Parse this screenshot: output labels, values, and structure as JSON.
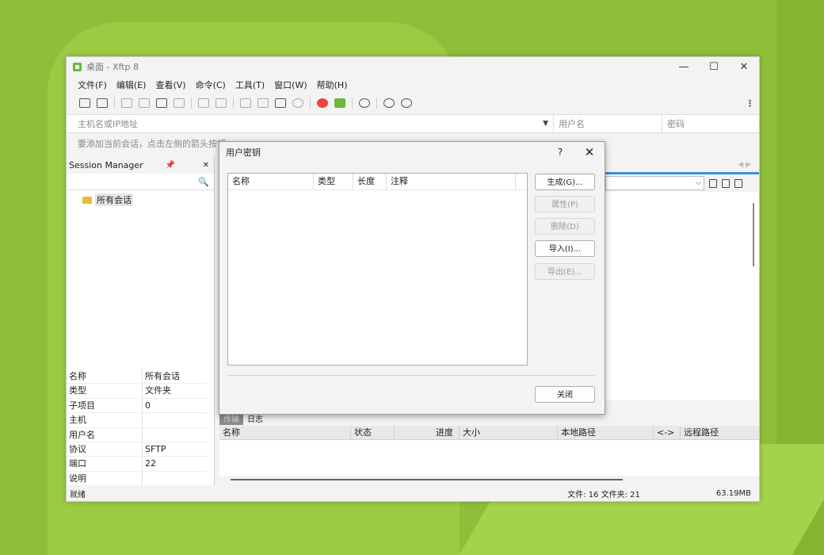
{
  "window": {
    "title": "桌面 - Xftp 8",
    "minimize": "—",
    "maximize": "☐",
    "close": "✕"
  },
  "menu": [
    "文件(F)",
    "编辑(E)",
    "查看(V)",
    "命令(C)",
    "工具(T)",
    "窗口(W)",
    "帮助(H)"
  ],
  "address": {
    "host_placeholder": "主机名或IP地址",
    "user_placeholder": "用户名",
    "pass_placeholder": "密码"
  },
  "hint": "要添加当前会话，点击左侧的箭头按钮",
  "session_manager": {
    "title": "Session Manager",
    "pin": "📌",
    "close": "✕",
    "search_icon": "🔍",
    "tree_root": "所有会话"
  },
  "properties": [
    {
      "k": "名称",
      "v": "所有会话"
    },
    {
      "k": "类型",
      "v": "文件夹"
    },
    {
      "k": "子项目",
      "v": "0"
    },
    {
      "k": "主机",
      "v": ""
    },
    {
      "k": "用户名",
      "v": ""
    },
    {
      "k": "协议",
      "v": "SFTP"
    },
    {
      "k": "端口",
      "v": "22"
    },
    {
      "k": "说明",
      "v": ""
    }
  ],
  "transfer": {
    "tabs": [
      "传输",
      "日志"
    ],
    "columns": [
      "名称",
      "状态",
      "进度",
      "大小",
      "本地路径",
      "<->",
      "远程路径"
    ]
  },
  "status": {
    "ready": "就绪",
    "files": "文件: 16  文件夹: 21",
    "size": "63.19MB"
  },
  "dialog": {
    "title": "用户密钥",
    "help": "?",
    "close": "✕",
    "columns": [
      "名称",
      "类型",
      "长度",
      "注释"
    ],
    "buttons": {
      "generate": "生成(G)...",
      "properties": "属性(P)",
      "delete": "删除(D)",
      "import": "导入(I)...",
      "export": "导出(E)...",
      "close": "关闭"
    }
  }
}
